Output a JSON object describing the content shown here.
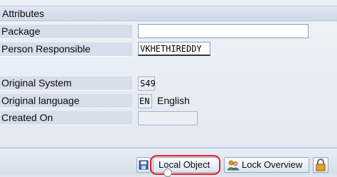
{
  "section": {
    "title": "Attributes"
  },
  "fields": {
    "package": {
      "label": "Package",
      "value": ""
    },
    "person_responsible": {
      "label": "Person Responsible",
      "value": "VKHETHIREDDY"
    },
    "original_system": {
      "label": "Original System",
      "value": "S49"
    },
    "original_language": {
      "label": "Original language",
      "code": "EN",
      "name": "English"
    },
    "created_on": {
      "label": "Created On",
      "value": ""
    }
  },
  "toolbar": {
    "local_object_label": "Local Object",
    "lock_overview_label": "Lock Overview"
  },
  "icons": {
    "save": "save-icon",
    "lock_overview": "users-icon",
    "extra": "padlock-icon"
  },
  "colors": {
    "highlight": "#ec1c24",
    "label_bg": "#d5deea",
    "panel_bg": "#e3e9f2"
  }
}
